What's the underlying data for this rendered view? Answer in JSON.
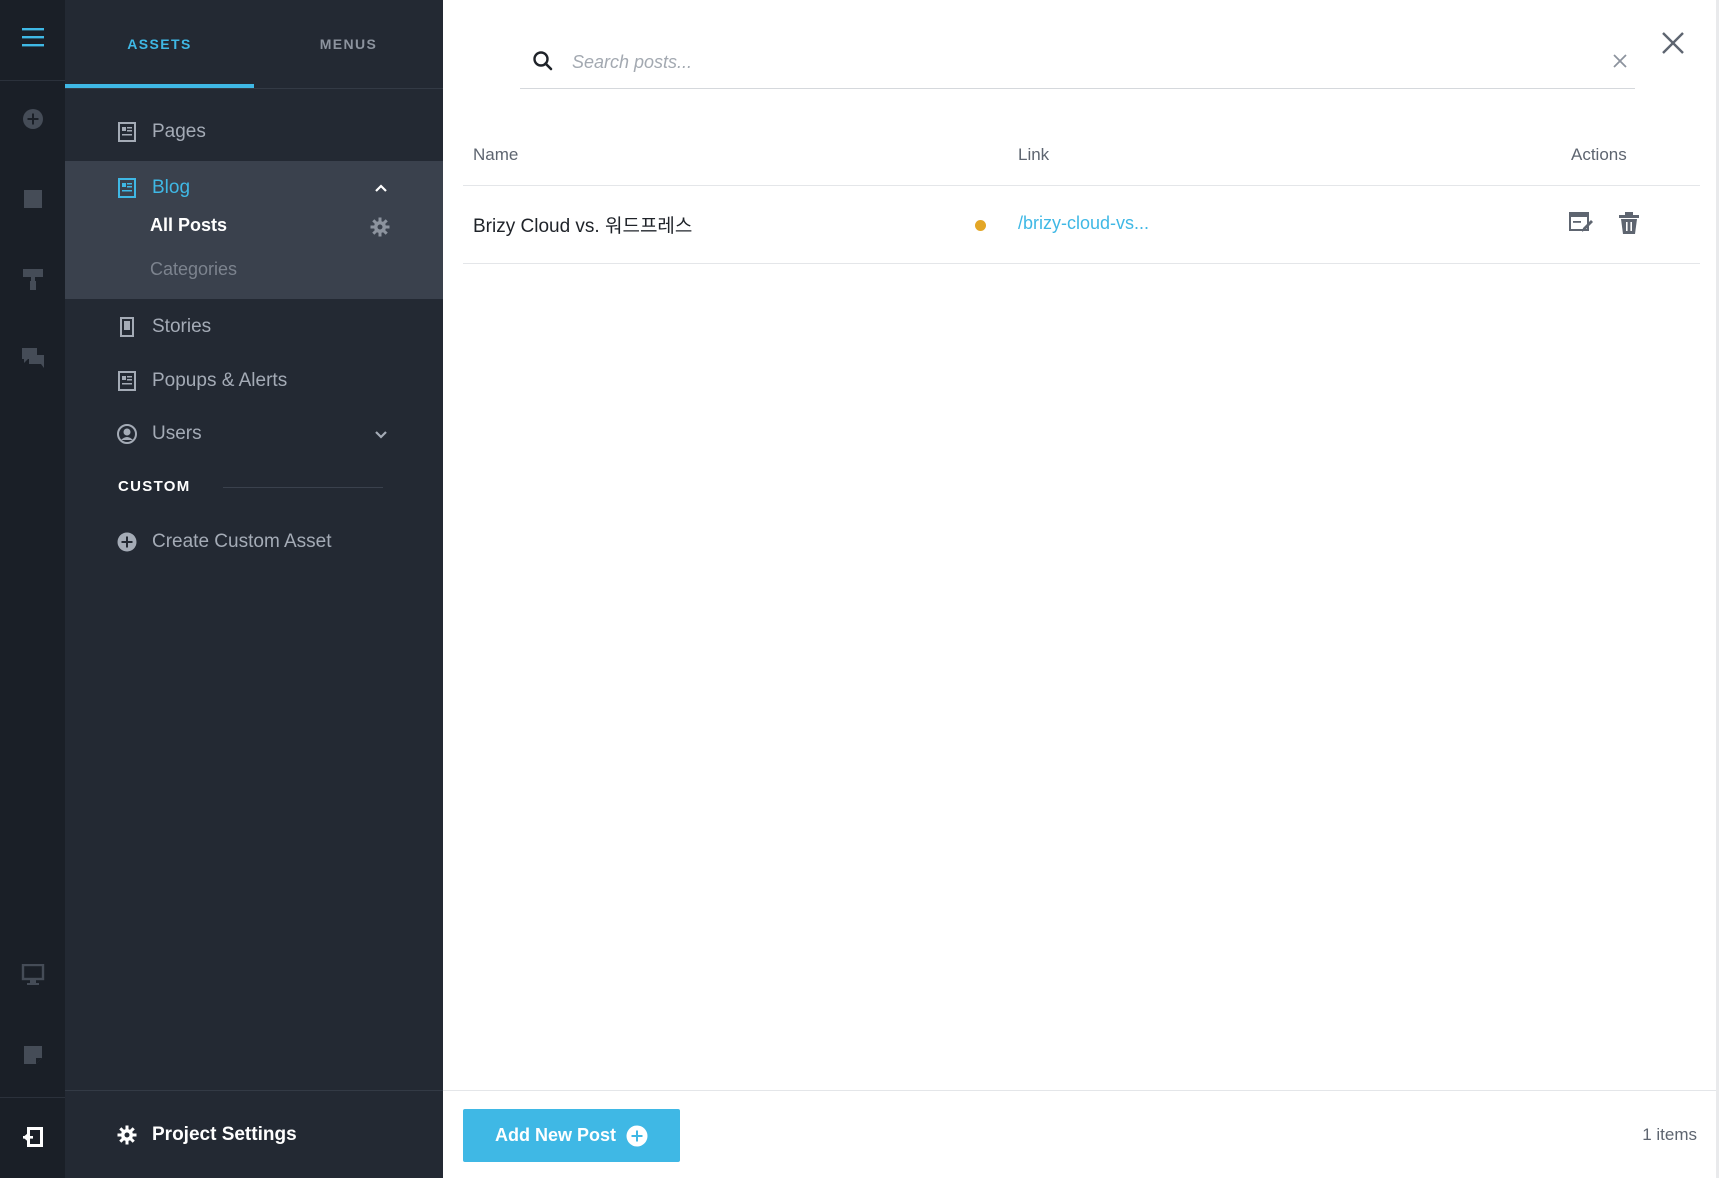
{
  "rail": {
    "icons": [
      "hamburger-icon",
      "add-circle-icon",
      "page-icon",
      "paint-roller-icon",
      "comments-icon",
      "desktop-icon",
      "note-icon",
      "exit-icon"
    ]
  },
  "panel": {
    "tabs": [
      {
        "label": "ASSETS",
        "active": true
      },
      {
        "label": "MENUS",
        "active": false
      }
    ],
    "nav": {
      "pages": "Pages",
      "blog": "Blog",
      "all_posts": "All Posts",
      "categories": "Categories",
      "stories": "Stories",
      "popups": "Popups & Alerts",
      "users": "Users"
    },
    "custom_heading": "CUSTOM",
    "create_custom": "Create Custom Asset",
    "project_settings": "Project Settings"
  },
  "main": {
    "search_placeholder": "Search posts...",
    "columns": {
      "name": "Name",
      "link": "Link",
      "actions": "Actions"
    },
    "rows": [
      {
        "name": "Brizy Cloud vs. 워드프레스",
        "status_color": "#e3a626",
        "link": "/brizy-cloud-vs..."
      }
    ],
    "add_button": "Add New Post",
    "items_count": "1 items"
  },
  "colors": {
    "accent": "#3fb8e5",
    "rail_bg": "#1a1f27",
    "panel_bg": "#232933",
    "active_block": "#3a414d",
    "status_draft": "#e3a626"
  }
}
